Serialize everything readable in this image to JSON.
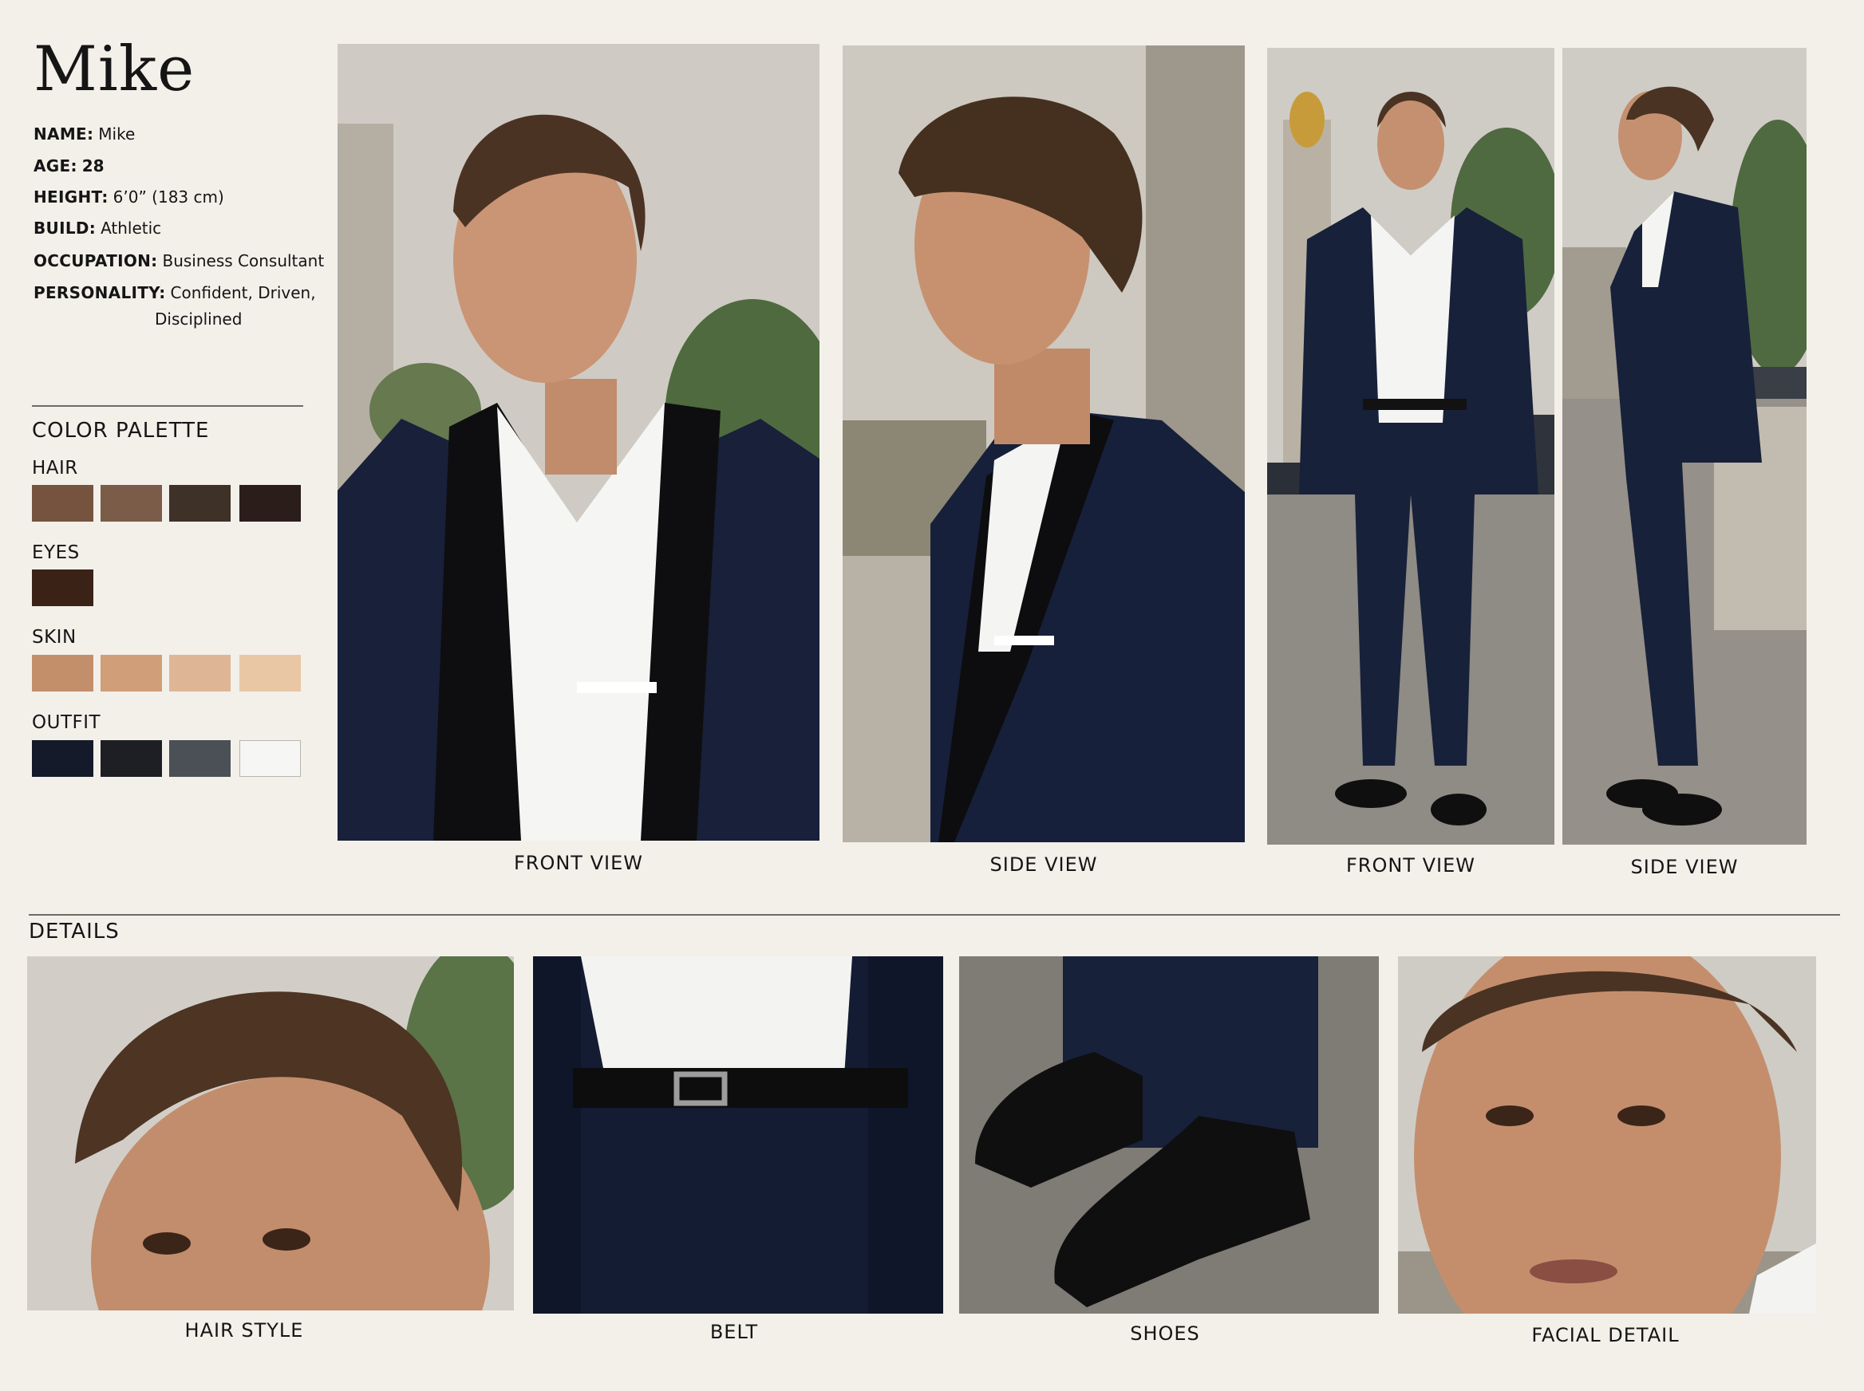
{
  "sheet": {
    "title": "Mike",
    "info": [
      {
        "label": "NAME:",
        "value": "Mike"
      },
      {
        "label": "AGE:",
        "value": "28"
      },
      {
        "label": "HEIGHT:",
        "value": "6’0” (183 cm)"
      },
      {
        "label": "BUILD:",
        "value": "Athletic"
      },
      {
        "label": "OCCUPATION:",
        "value": "Business Consultant"
      },
      {
        "label": "PERSONALITY:",
        "value": "Confident, Driven,",
        "value_cont": "Disciplined"
      }
    ],
    "palette": {
      "title": "COLOR PALETTE",
      "groups": [
        {
          "label": "HAIR",
          "colors": [
            "#75533f",
            "#7a5c48",
            "#3e3128",
            "#2a1d1a"
          ]
        },
        {
          "label": "EYES",
          "colors": [
            "#3b2217"
          ]
        },
        {
          "label": "SKIN",
          "colors": [
            "#c38f6b",
            "#d09e78",
            "#dfb695",
            "#e9c7a5"
          ]
        },
        {
          "label": "OUTFIT",
          "colors": [
            "#141a2a",
            "#1e1f24",
            "#4b4f56",
            "#f6f6f5"
          ]
        }
      ]
    },
    "views": [
      {
        "caption": "FRONT VIEW",
        "icon": "portrait-front-photo"
      },
      {
        "caption": "SIDE VIEW",
        "icon": "portrait-side-photo"
      },
      {
        "caption": "FRONT VIEW",
        "icon": "fullbody-front-photo"
      },
      {
        "caption": "SIDE VIEW",
        "icon": "fullbody-side-photo"
      }
    ],
    "details_title": "DETAILS",
    "details": [
      {
        "caption": "HAIR STYLE",
        "icon": "hair-detail-photo"
      },
      {
        "caption": "BELT",
        "icon": "belt-detail-photo"
      },
      {
        "caption": "SHOES",
        "icon": "shoes-detail-photo"
      },
      {
        "caption": "FACIAL DETAIL",
        "icon": "face-detail-photo"
      }
    ]
  }
}
